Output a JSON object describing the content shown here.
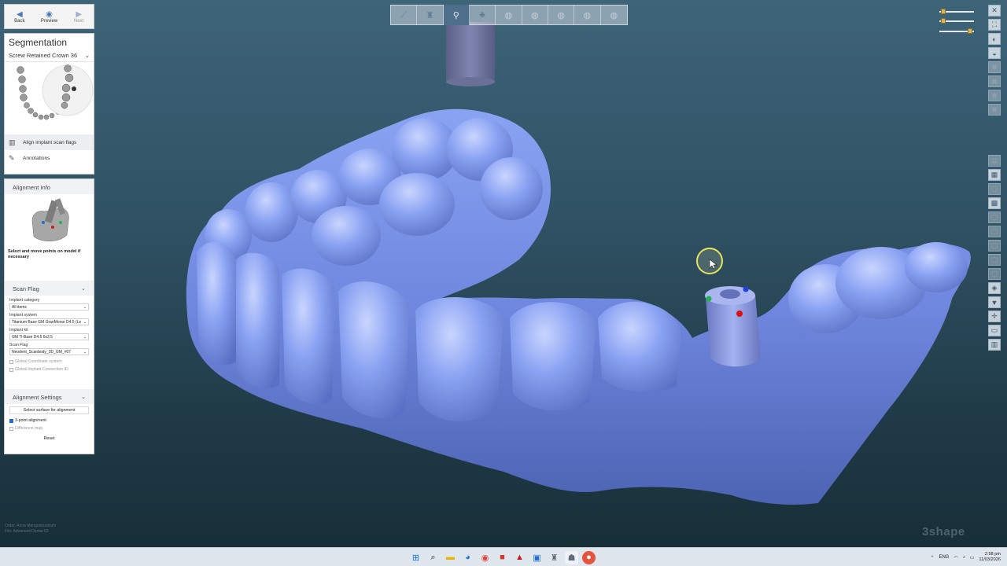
{
  "nav": {
    "back_label": "Back",
    "preview_label": "Preview",
    "next_label": "Next"
  },
  "segmentation": {
    "title": "Segmentation",
    "selected": "Screw Retained Crown 36",
    "items": [
      {
        "label": "Align implant scan flags",
        "icon": "scanflag-icon"
      },
      {
        "label": "Annotations",
        "icon": "annotation-icon"
      }
    ]
  },
  "alignment_info": {
    "header": "Alignment Info",
    "hint": "Select and move points on model if necessary"
  },
  "scan_flag": {
    "header": "Scan Flag",
    "fields": [
      {
        "label": "Implant category",
        "value": "All items"
      },
      {
        "label": "Implant system",
        "value": "Titanium Base GM GranMorse D4.5 (Le"
      },
      {
        "label": "Implant kit",
        "value": "GM Ti-Base D4.5 6x2.5"
      },
      {
        "label": "Scan Flag",
        "value": "Neodent_Scanbody_3D_GM_#07"
      }
    ],
    "global_coordinate": "Global Coordinate system",
    "global_connection": "Global Implant Connection ID"
  },
  "alignment_settings": {
    "header": "Alignment Settings",
    "select_surface": "Select surface for alignment",
    "three_point": "3-point alignment",
    "difference_map": "Difference map",
    "reset": "Reset"
  },
  "status": {
    "line1": "Order: Anne Mengonkuntoshi",
    "line2": "File: Advanced Dental 63"
  },
  "brand": "3shape",
  "taskbar": {
    "lang": "ENG",
    "time": "2:58 pm",
    "date": "11/03/2026"
  },
  "colors": {
    "model": "#7a93e8",
    "scanbody": "#8189c4",
    "background_top": "#3e6478",
    "background_bottom": "#172d36",
    "cursor_ring": "#e8e35a"
  }
}
